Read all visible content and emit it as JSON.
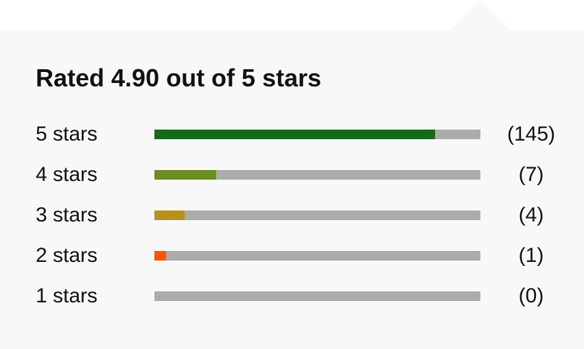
{
  "rating": {
    "title": "Rated 4.90 out of 5 stars"
  },
  "breakdown": [
    {
      "label": "5 stars",
      "count": "(145)",
      "fill_fraction": 0.86,
      "color": "#136c13"
    },
    {
      "label": "4 stars",
      "count": "(7)",
      "fill_fraction": 0.19,
      "color": "#6b8e23"
    },
    {
      "label": "3 stars",
      "count": "(4)",
      "fill_fraction": 0.093,
      "color": "#b8901f"
    },
    {
      "label": "2 stars",
      "count": "(1)",
      "fill_fraction": 0.035,
      "color": "#ff5500"
    },
    {
      "label": "1 stars",
      "count": "(0)",
      "fill_fraction": 0,
      "color": "#ababab"
    }
  ],
  "colors": {
    "track": "#ababab",
    "panel_background": "#f8f8f8"
  }
}
